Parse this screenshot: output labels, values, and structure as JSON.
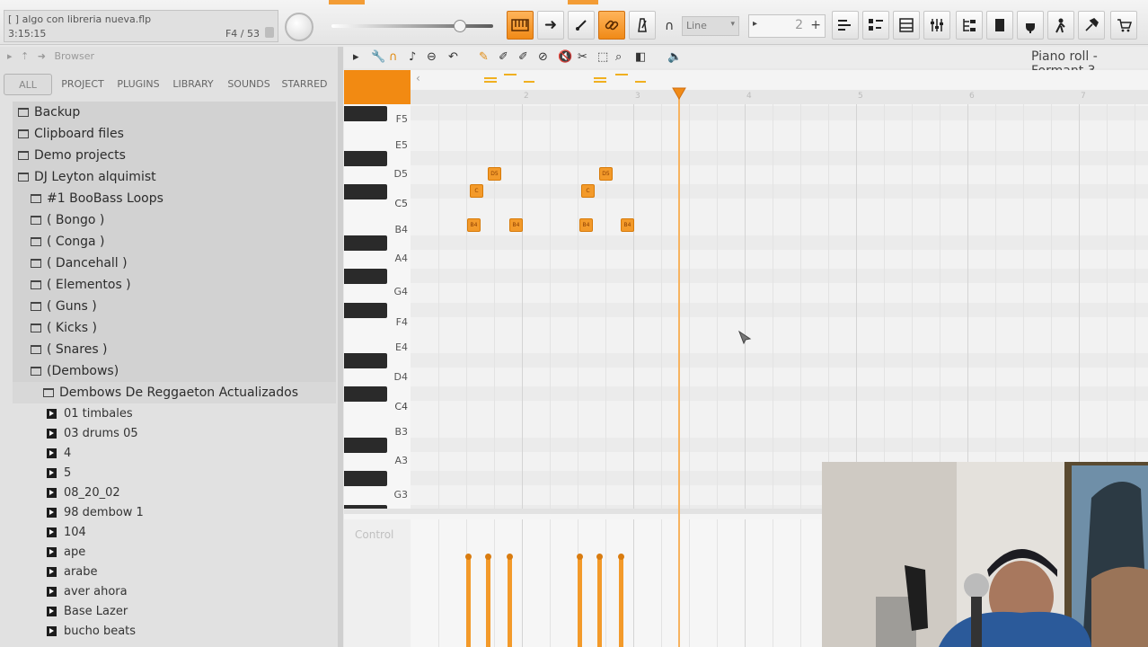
{
  "topbar": {
    "hint_title": "[  ] algo con libreria nueva.flp",
    "hint_time": "3:15:15",
    "hint_step": "F4 / 53",
    "snap_label": "Line",
    "step_value": "2",
    "accent_color": "#f28a12"
  },
  "browser": {
    "title": "Browser",
    "tabs": [
      "ALL",
      "PROJECT",
      "PLUGINS",
      "LIBRARY",
      "SOUNDS",
      "STARRED"
    ],
    "folders": [
      "Backup",
      "Clipboard files",
      "Demo projects",
      "DJ Leyton alquimist",
      "#1 BooBass Loops",
      "( Bongo )",
      "( Conga )",
      "( Dancehall )",
      "( Elementos )",
      "( Guns )",
      "( Kicks )",
      "( Snares )",
      "(Dembows)",
      "Dembows De Reggaeton Actualizados"
    ],
    "files": [
      "01 timbales",
      "03 drums 05",
      "4",
      "5",
      "08_20_02",
      "98 dembow 1",
      "104",
      "ape",
      "arabe",
      "aver ahora",
      "Base Lazer",
      "bucho beats"
    ]
  },
  "piano_roll": {
    "title": "Piano roll - Formant 3",
    "control_label": "Control",
    "key_labels": [
      "F5",
      "E5",
      "D5",
      "C5",
      "B4",
      "A4",
      "G4",
      "F4",
      "E4",
      "D4",
      "C4",
      "B3",
      "A3",
      "G3"
    ],
    "ruler_numbers": [
      "2",
      "3",
      "4",
      "5",
      "6",
      "7"
    ],
    "notes": [
      {
        "label": "D5",
        "pitch": "D5"
      },
      {
        "label": "C",
        "pitch": "C#5"
      },
      {
        "label": "B4",
        "pitch": "B4"
      },
      {
        "label": "B4",
        "pitch": "B4"
      },
      {
        "label": "D5",
        "pitch": "D5"
      },
      {
        "label": "C",
        "pitch": "C#5"
      },
      {
        "label": "B4",
        "pitch": "B4"
      },
      {
        "label": "B4",
        "pitch": "B4"
      }
    ]
  },
  "icons": [
    "folder-icon",
    "audio-file-icon",
    "tempo-knob",
    "piano-roll-icon",
    "snap-magnet-icon"
  ]
}
